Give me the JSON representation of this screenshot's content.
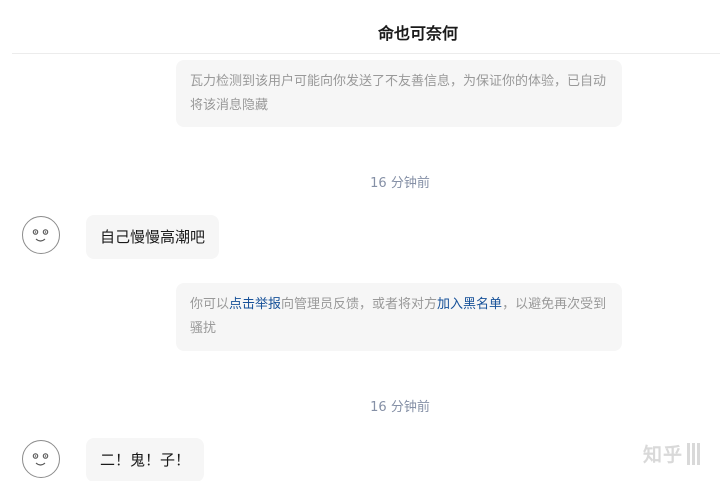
{
  "header": {
    "title": "命也可奈何"
  },
  "messages": [
    {
      "type": "notice",
      "text": "瓦力检测到该用户可能向你发送了不友善信息，为保证你的体验，已自动将该消息隐藏"
    },
    {
      "type": "timestamp",
      "text": "16 分钟前"
    },
    {
      "type": "message",
      "avatar_icon": "smiley-face-icon",
      "text": "自己慢慢高潮吧"
    },
    {
      "type": "notice",
      "prefix": "你可以",
      "report_link": "点击举报",
      "middle": "向管理员反馈，或者将对方",
      "blacklist_link": "加入黑名单",
      "suffix": "，以避免再次受到骚扰"
    },
    {
      "type": "timestamp",
      "text": "16 分钟前"
    },
    {
      "type": "message",
      "avatar_icon": "smiley-face-icon",
      "text": "二！鬼！子！"
    }
  ],
  "watermark": {
    "text": "知乎"
  },
  "colors": {
    "link": "#175199",
    "notice_text": "#999999",
    "bubble_bg": "#f6f6f6",
    "timestamp": "#8590a6"
  }
}
